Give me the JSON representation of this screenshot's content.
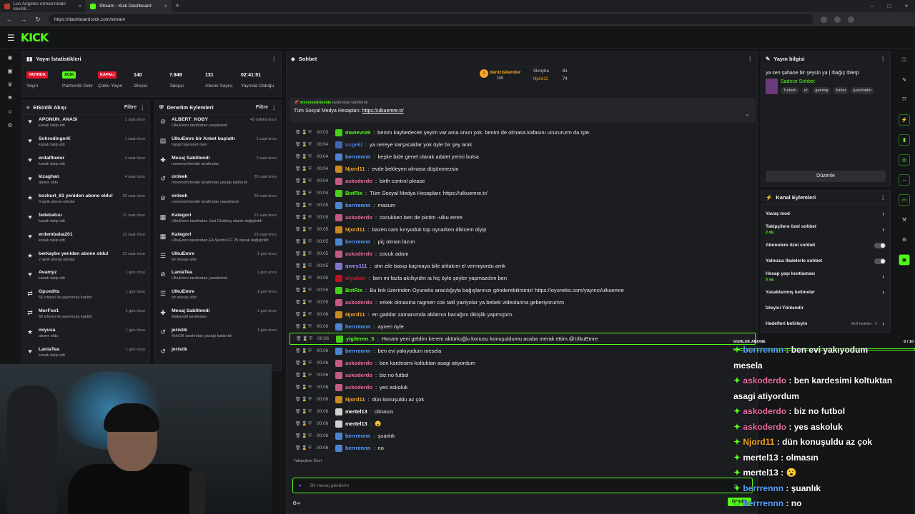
{
  "browser": {
    "tabs": [
      {
        "title": "Los Angeles ormanındaki kavisli..."
      },
      {
        "title": "Stream - Kick Dashboard"
      }
    ],
    "url": "https://dashboard.kick.com/stream"
  },
  "brand": {
    "logo": "KICK",
    "accent": "#53fc18"
  },
  "stats": {
    "title": "Yayın İstatistikleri",
    "items": [
      {
        "badge": "YAYINDA",
        "label": "Yayın"
      },
      {
        "badge": "AÇIK",
        "label": "Partnerlik Gelir"
      },
      {
        "badge": "KAPALI",
        "label": "Çoklu Yayın"
      },
      {
        "value": "140",
        "label": "İzleyici"
      },
      {
        "value": "7.949",
        "label": "Takipçi"
      },
      {
        "value": "131",
        "label": "Abone Sayısı"
      },
      {
        "value": "02:41:51",
        "label": "Yayında Olduğu"
      }
    ]
  },
  "activity": {
    "title": "Etkinlik Akışı",
    "filter": "Filtre",
    "items": [
      {
        "name": "APONUN_ANASI",
        "sub": "kanalı takip etti",
        "time": "1 saat önce"
      },
      {
        "name": "SchrodingerK",
        "sub": "kanalı takip etti",
        "time": "1 saat önce"
      },
      {
        "name": "erdalflower",
        "sub": "kanalı takip etti",
        "time": "4 saat önce"
      },
      {
        "name": "kizaghan",
        "sub": "abone oldu",
        "time": "4 saat önce"
      },
      {
        "name": "bozkurt_61 yeniden abone oldu!",
        "sub": "3 aylık abone oldular",
        "time": "20 saat önce"
      },
      {
        "name": "fedebatuu",
        "sub": "kanalı takip etti",
        "time": "21 saat önce"
      },
      {
        "name": "erdembaba201",
        "sub": "kanalı takip etti",
        "time": "21 saat önce"
      },
      {
        "name": "berkaybe yeniden abone oldu!",
        "sub": "2 aylık abone oldular",
        "time": "21 saat önce"
      },
      {
        "name": "Avamyz",
        "sub": "kanalı takip etti",
        "time": "1 gün önce"
      },
      {
        "name": "Gpcedits",
        "sub": "56 izleyici ile yayınınıza katıldı!",
        "time": "1 gün önce"
      },
      {
        "name": "MorFox1",
        "sub": "60 izleyici ile yayınınıza katıldı!",
        "time": "1 gün önce"
      },
      {
        "name": "miyusa",
        "sub": "abone oldu",
        "time": "1 gün önce"
      },
      {
        "name": "LaniaTea",
        "sub": "kanalı takip etti",
        "time": "1 gün önce"
      }
    ]
  },
  "modactions": {
    "title": "Denetim Eylemleri",
    "filter": "Filtre",
    "items": [
      {
        "name": "ALBERT_KOBY",
        "sub": "UlkuEmre tarafından yasaklandı",
        "time": "45 dakika önce"
      },
      {
        "name": "UlkuEmre bir Anket başlattı",
        "sub": "hangi hayvanım ben",
        "time": "1 saat önce"
      },
      {
        "name": "Mesaj Sabitlendi",
        "sub": "mxxenontrioxide tarafından",
        "time": "2 saat önce"
      },
      {
        "name": "ordeek",
        "sub": "mxxenontrioxide tarafından yasağı kaldırıldı",
        "time": "20 saat önce"
      },
      {
        "name": "ordeek",
        "sub": "mxxenontrioxide tarafından yasaklandı",
        "time": "20 saat önce"
      },
      {
        "name": "Kategori",
        "sub": "UlkuEmre tarafından Just Chatting olarak değiştirildi",
        "time": "21 saat önce"
      },
      {
        "name": "Kategori",
        "sub": "UlkuEmre tarafından EA Sports FC 25 olarak değiştirildi",
        "time": "23 saat önce"
      },
      {
        "name": "UlkuEmre",
        "sub": "bir mesajı sildi",
        "time": "1 gün önce"
      },
      {
        "name": "LaniaTea",
        "sub": "UlkuEmre tarafından yasaklandı",
        "time": "1 gün önce"
      },
      {
        "name": "UlkuEmre",
        "sub": "bir mesajı sildi",
        "time": "1 gün önce"
      },
      {
        "name": "Mesaj Sabitlendi",
        "sub": "Makavelli tarafından",
        "time": "1 gün önce"
      },
      {
        "name": "jeristik",
        "sub": "flelnGK tarafından yasağı kaldırıldı",
        "time": "1 gün önce"
      },
      {
        "name": "jeristik",
        "sub": "",
        "time": ""
      }
    ]
  },
  "chat": {
    "title": "Sohbet",
    "top_gifters": [
      {
        "name": "deniziskender",
        "amount": "105"
      },
      {
        "name": "Slonyha",
        "amount": "81"
      },
      {
        "name": "Njord11",
        "amount": "74"
      }
    ],
    "pinned": {
      "by": "mxxenontrioxide",
      "by_suffix": "tarafından sabitlendi",
      "text": "Tüm Sosyal Medya Hesapları:",
      "link": "https://ulkuemre.tr/"
    },
    "messages": [
      {
        "time": "00:03",
        "user": "manevra9",
        "color": "#53fc18",
        "text": "benim kaybedecek şeyim var ama onun yok. benim de olmasa kafasını ucurururm da işte."
      },
      {
        "time": "00:04",
        "user": "usgeki",
        "color": "#4a7bd4",
        "text": "ya nereye karşacaklar yok öyle bir şey amk"
      },
      {
        "time": "00:04",
        "user": "berrrennn",
        "color": "#5aa0ff",
        "text": "keşke bide genel olarak adalet yerini bulsa"
      },
      {
        "time": "00:04",
        "user": "Njord11",
        "color": "#f5a623",
        "text": "evde bekleyen olmasa düşünmezsin"
      },
      {
        "time": "00:04",
        "user": "askoderdo",
        "color": "#f06aa0",
        "text": "birth control please"
      },
      {
        "time": "00:04",
        "user": "BotRix",
        "color": "#53fc18",
        "text": "Tüm Sosyal Medya Hesapları: https://ulkuemre.tr/"
      },
      {
        "time": "00:05",
        "user": "berrrennn",
        "color": "#5aa0ff",
        "text": "masum"
      },
      {
        "time": "00:05",
        "user": "askoderdo",
        "color": "#f06aa0",
        "text": "cocukken ben de pictim -ulku emre"
      },
      {
        "time": "00:05",
        "user": "Njord11",
        "color": "#f5a623",
        "text": "bazen cam kırıyoduk top oynarken dikicem diyip"
      },
      {
        "time": "00:05",
        "user": "berrrennn",
        "color": "#5aa0ff",
        "text": "piç olman lazım"
      },
      {
        "time": "00:05",
        "user": "askoderdo",
        "color": "#f06aa0",
        "text": "cocuk adam"
      },
      {
        "time": "00:05",
        "user": "qwey111",
        "color": "#9b8cff",
        "text": "olm zile basıp kaçmaya bile ahlakım el vermiyordu amk"
      },
      {
        "time": "00:05",
        "user": "diyuben",
        "color": "#e0142b",
        "text": "ben mi fazla akıllıyıdm ia hiç öyle şeyler yapmazdım ben"
      },
      {
        "time": "00:05",
        "user": "BotRix",
        "color": "#53fc18",
        "text": "Bu link üzerinden Oyuneks aracılığıyla bağışlarınızı gönderebilirsiniz! https://oyuneks.com/yayinci/ulkuemre"
      },
      {
        "time": "00:05",
        "user": "askoderdo",
        "color": "#f06aa0",
        "text": "erkek olmasina ragmen cok tatil yaziyolar ya bebek videolarina geberiyorumm"
      },
      {
        "time": "00:06",
        "user": "Njord11",
        "color": "#f5a623",
        "text": "en gaddar zamanımda ablamın bacağını dikişlik yapmıştım."
      },
      {
        "time": "00:06",
        "user": "berrrennn",
        "color": "#5aa0ff",
        "text": "aynen öyle"
      },
      {
        "time": "00:06",
        "user": "yigiteren_5",
        "color": "#53fc18",
        "text": "Hocam yeni geldim kerem aktürkoğlu konusu konuşuldumu acaba merak ettim @UlkuEmre"
      },
      {
        "time": "00:06",
        "user": "berrrennn",
        "color": "#5aa0ff",
        "text": "ben evi yakıyodum mesela"
      },
      {
        "time": "00:06",
        "user": "askoderdo",
        "color": "#f06aa0",
        "text": "ben kardesimi koltuktan asagi atiyordum"
      },
      {
        "time": "00:06",
        "user": "askoderdo",
        "color": "#f06aa0",
        "text": "biz no futbol"
      },
      {
        "time": "00:06",
        "user": "askoderdo",
        "color": "#f06aa0",
        "text": "yes askoluk"
      },
      {
        "time": "00:06",
        "user": "Njord11",
        "color": "#f5a623",
        "text": "dün konuşuldu az çok"
      },
      {
        "time": "00:06",
        "user": "mertel13",
        "color": "#ffffff",
        "text": "olmasın"
      },
      {
        "time": "00:06",
        "user": "mertel13",
        "color": "#ffffff",
        "text": "😮"
      },
      {
        "time": "00:06",
        "user": "berrrennn",
        "color": "#5aa0ff",
        "text": "şuanlık"
      },
      {
        "time": "00:06",
        "user": "berrrennn",
        "color": "#5aa0ff",
        "text": "no"
      }
    ],
    "followers_only": "Takipçilere Özel",
    "input_placeholder": "Bir mesaj gönderin",
    "send_label": "Gönder"
  },
  "streaminfo": {
    "title": "Yayın bilgisi",
    "stream_title": "ya sen şahane bir şeysin ya | !bağış !blerp",
    "category": "Sadece Sohbet",
    "tags": [
      "Turkish",
      "ırl",
      "gaming",
      "futbol",
      "justchattin"
    ],
    "edit_label": "Düzenle"
  },
  "chanactions": {
    "title": "Kanal Eylemleri",
    "items": [
      {
        "label": "Yavaş mod",
        "sub": "",
        "kind": "chevron"
      },
      {
        "label": "Takipçilere özel sohbet",
        "sub": "2 dk.",
        "kind": "chevron"
      },
      {
        "label": "Abonelere özel sohbet",
        "sub": "",
        "kind": "toggle"
      },
      {
        "label": "Yalnızca ifadelerle sohbet",
        "sub": "",
        "kind": "toggle"
      },
      {
        "label": "Hesap yaşı kısıtlaması",
        "sub": "5 sa.",
        "kind": "chevron"
      },
      {
        "label": "Yasaklanmış kelimeler",
        "sub": "",
        "kind": "chevron"
      },
      {
        "label": "İzleyici Yönlendir",
        "sub": "",
        "kind": "none"
      },
      {
        "label": "Hedefleri belirleyin",
        "sub": "",
        "kind": "chevron",
        "note": "Aktif hedefler - 2"
      }
    ]
  },
  "overlay": {
    "goal_label": "GÜNLÜK ABONE",
    "goal_count": "0 / 10",
    "lines": [
      {
        "user": "berrrennn",
        "text": "ben evi yakıyodum",
        "color": "#5aa0ff"
      },
      {
        "user": "",
        "text": "mesela",
        "color": "#ffffff"
      },
      {
        "user": "askoderdo",
        "text": "ben kardesimi koltuktan",
        "color": "#f06aa0"
      },
      {
        "user": "",
        "text": "asagi atiyordum",
        "color": "#ffffff"
      },
      {
        "user": "askoderdo",
        "text": "biz no futbol",
        "color": "#f06aa0"
      },
      {
        "user": "askoderdo",
        "text": "yes askoluk",
        "color": "#f06aa0"
      },
      {
        "user": "Njord11",
        "text": "dün konuşuldu az çok",
        "color": "#f5a623"
      },
      {
        "user": "mertel13",
        "text": "olmasın",
        "color": "#ffffff"
      },
      {
        "user": "mertel13",
        "text": "😮",
        "color": "#ffffff"
      },
      {
        "user": "berrrennn",
        "text": "şuanlık",
        "color": "#5aa0ff"
      },
      {
        "user": "berrrennn",
        "text": "no",
        "color": "#5aa0ff"
      }
    ]
  }
}
